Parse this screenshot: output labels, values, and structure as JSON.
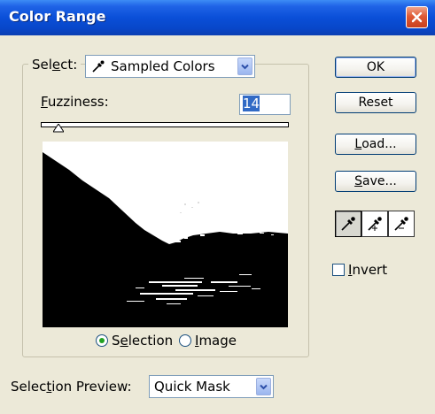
{
  "window": {
    "title": "Color Range"
  },
  "select": {
    "label_pre": "Sel",
    "label_ul": "e",
    "label_post": "ct:",
    "value": "Sampled Colors"
  },
  "fuzziness": {
    "label_ul": "F",
    "label_post": "uzziness:",
    "value": "14",
    "slider_fraction": 0.07
  },
  "radios": {
    "selection": {
      "label_pre": "S",
      "label_ul": "e",
      "label_post": "lection",
      "checked": true
    },
    "image": {
      "label_ul": "I",
      "label_post": "mage",
      "checked": false
    }
  },
  "selection_preview": {
    "label_pre": "Selec",
    "label_ul": "t",
    "label_post": "ion Preview:",
    "value": "Quick Mask"
  },
  "buttons": {
    "ok": "OK",
    "reset": "Reset",
    "load": {
      "ul": "L",
      "post": "oad..."
    },
    "save": {
      "ul": "S",
      "post": "ave..."
    }
  },
  "invert": {
    "ul": "I",
    "post": "nvert",
    "checked": false
  },
  "icons": {
    "close": "close-icon",
    "eyedropper": "eyedropper-icon",
    "eyedropper_plus": "eyedropper-plus-icon",
    "eyedropper_minus": "eyedropper-minus-icon",
    "dropdown": "chevron-down-icon"
  },
  "colors": {
    "title_bar": "#0a4fd8",
    "dialog_bg": "#ece9d8",
    "close_button": "#e05a35",
    "radio_dot": "#21a121"
  }
}
